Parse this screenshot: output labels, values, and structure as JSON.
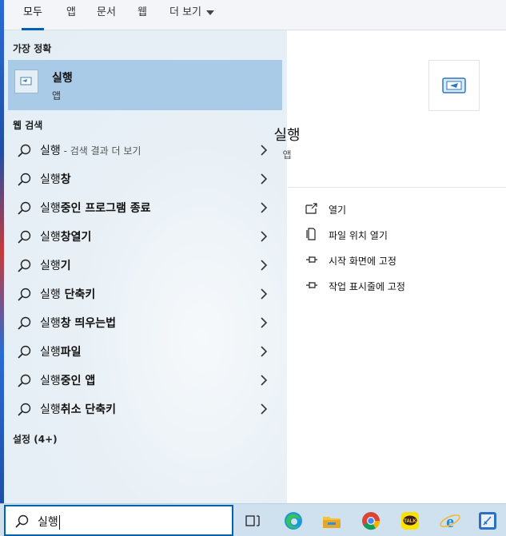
{
  "tabs": [
    {
      "label": "모두"
    },
    {
      "label": "앱"
    },
    {
      "label": "문서"
    },
    {
      "label": "웹"
    },
    {
      "label": "더 보기"
    }
  ],
  "best_match": {
    "heading": "가장 정확",
    "title": "실행",
    "subtitle": "앱"
  },
  "web_search": {
    "heading": "웹 검색",
    "items": [
      {
        "bold": "실행",
        "rest": "",
        "suffix": " - 검색 결과 더 보기"
      },
      {
        "bold": "실행",
        "rest": "창",
        "suffix": ""
      },
      {
        "bold": "실행",
        "rest": "중인 프로그램 종료",
        "suffix": ""
      },
      {
        "bold": "실행",
        "rest": "창열기",
        "suffix": ""
      },
      {
        "bold": "실행",
        "rest": "기",
        "suffix": ""
      },
      {
        "bold": "실행",
        "rest": " 단축키",
        "suffix": ""
      },
      {
        "bold": "실행",
        "rest": "창 띄우는법",
        "suffix": ""
      },
      {
        "bold": "실행",
        "rest": "파일",
        "suffix": ""
      },
      {
        "bold": "실행",
        "rest": "중인 앱",
        "suffix": ""
      },
      {
        "bold": "실행",
        "rest": "취소 단축키",
        "suffix": ""
      }
    ]
  },
  "settings": {
    "heading": "설정 (4+)"
  },
  "detail": {
    "title": "실행",
    "subtitle": "앱",
    "actions": [
      {
        "label": "열기",
        "icon": "open-icon"
      },
      {
        "label": "파일 위치 열기",
        "icon": "file-location-icon"
      },
      {
        "label": "시작 화면에 고정",
        "icon": "pin-icon"
      },
      {
        "label": "작업 표시줄에 고정",
        "icon": "pin-icon"
      }
    ]
  },
  "search": {
    "value": "실행"
  },
  "taskbar": {
    "apps": [
      "task-view-icon",
      "edge-icon",
      "file-explorer-icon",
      "chrome-icon",
      "kakaotalk-icon",
      "internet-explorer-icon",
      "sticky-app-icon"
    ],
    "kakao_label": "TALK"
  },
  "colors": {
    "accent": "#0063b1",
    "selected": "#a9cbe7",
    "taskbar": "#cfe0ee"
  }
}
